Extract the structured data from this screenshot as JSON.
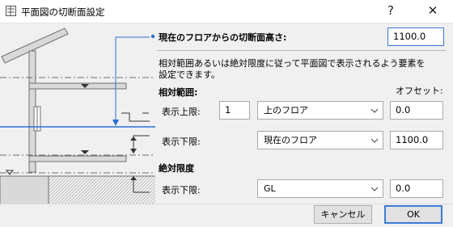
{
  "window": {
    "title": "平面図の切断面設定",
    "help_glyph": "?",
    "close_glyph": "✕"
  },
  "cut_height": {
    "label": "現在のフロアからの切断面高さ:",
    "value": "1100.0"
  },
  "description": {
    "line1": "相対範囲あるいは絶対限度に従って平面図で表示されるよう要素を",
    "line2": "設定できます。"
  },
  "relative_range": {
    "heading": "相対範囲:",
    "offset_heading": "オフセット:",
    "upper": {
      "label": "表示上限:",
      "count": "1",
      "floor": "上のフロア",
      "offset": "0.0"
    },
    "lower": {
      "label": "表示下限:",
      "floor": "現在のフロア",
      "offset": "1100.0"
    }
  },
  "absolute_limit": {
    "heading": "絶対限度",
    "lower": {
      "label": "表示下限:",
      "level": "GL",
      "offset": "0.0"
    }
  },
  "buttons": {
    "cancel": "キャンセル",
    "ok": "OK"
  },
  "colors": {
    "accent": "#3c7bd6",
    "cut_line": "#2a6fd6",
    "dialog_bg": "#f0f0f0"
  }
}
